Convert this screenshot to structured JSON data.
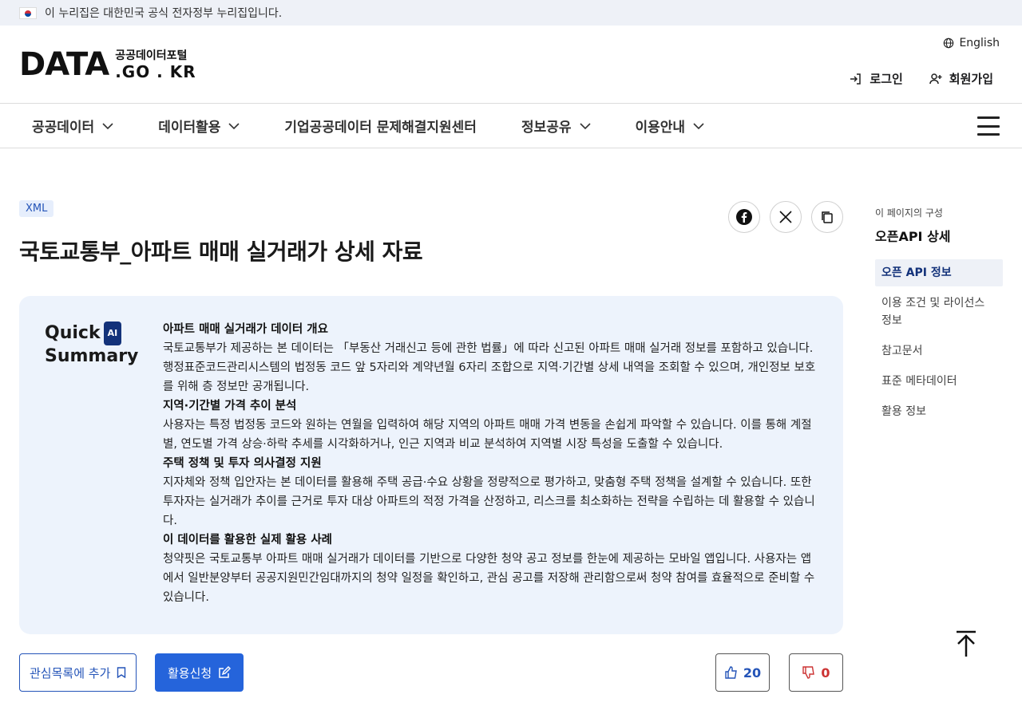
{
  "gov_banner": {
    "text": "이 누리집은 대한민국 공식 전자정부 누리집입니다."
  },
  "header": {
    "logo_main": "DATA",
    "logo_ko": "공공데이터포털",
    "logo_domain": ".GO . KR",
    "language": "English",
    "login": "로그인",
    "signup": "회원가입"
  },
  "nav": {
    "items": [
      {
        "label": "공공데이터",
        "has_dropdown": true
      },
      {
        "label": "데이터활용",
        "has_dropdown": true
      },
      {
        "label": "기업공공데이터 문제해결지원센터",
        "has_dropdown": false
      },
      {
        "label": "정보공유",
        "has_dropdown": true
      },
      {
        "label": "이용안내",
        "has_dropdown": true
      }
    ]
  },
  "main": {
    "badge": "XML",
    "title": "국토교통부_아파트 매매 실거래가 상세 자료",
    "summary": {
      "head_quick": "Quick",
      "head_ai": "AI",
      "head_summary": "Summary",
      "sections": [
        {
          "heading": "아파트 매매 실거래가 데이터 개요",
          "text": "국토교통부가 제공하는 본 데이터는 「부동산 거래신고 등에 관한 법률」에 따라 신고된 아파트 매매 실거래 정보를 포함하고 있습니다. 행정표준코드관리시스템의 법정동 코드 앞 5자리와 계약년월 6자리 조합으로 지역·기간별 상세 내역을 조회할 수 있으며, 개인정보 보호를 위해 층 정보만 공개됩니다."
        },
        {
          "heading": "지역·기간별 가격 추이 분석",
          "text": "사용자는 특정 법정동 코드와 원하는 연월을 입력하여 해당 지역의 아파트 매매 가격 변동을 손쉽게 파악할 수 있습니다. 이를 통해 계절별, 연도별 가격 상승·하락 추세를 시각화하거나, 인근 지역과 비교 분석하여 지역별 시장 특성을 도출할 수 있습니다."
        },
        {
          "heading": "주택 정책 및 투자 의사결정 지원",
          "text": "지자체와 정책 입안자는 본 데이터를 활용해 주택 공급·수요 상황을 정량적으로 평가하고, 맞춤형 주택 정책을 설계할 수 있습니다. 또한 투자자는 실거래가 추이를 근거로 투자 대상 아파트의 적정 가격을 산정하고, 리스크를 최소화하는 전략을 수립하는 데 활용할 수 있습니다."
        },
        {
          "heading": "이 데이터를 활용한 실제 활용 사례",
          "text": "청약핏은 국토교통부 아파트 매매 실거래가 데이터를 기반으로 다양한 청약 공고 정보를 한눈에 제공하는 모바일 앱입니다. 사용자는 앱에서 일반분양부터 공공지원민간임대까지의 청약 일정을 확인하고, 관심 공고를 저장해 관리함으로써 청약 참여를 효율적으로 준비할 수 있습니다."
        }
      ]
    },
    "actions": {
      "wishlist": "관심목록에 추가",
      "apply": "활용신청",
      "likes": "20",
      "dislikes": "0"
    }
  },
  "toc": {
    "caption": "이 페이지의 구성",
    "title": "오픈API 상세",
    "items": [
      "오픈 API 정보",
      "이용 조건 및 라이선스 정보",
      "참고문서",
      "표준 메타데이터",
      "활용 정보"
    ],
    "active_index": 0
  }
}
